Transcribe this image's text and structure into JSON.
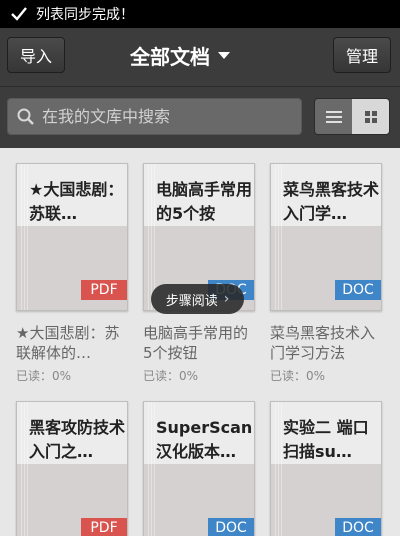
{
  "status": {
    "message": "列表同步完成！"
  },
  "header": {
    "import_label": "导入",
    "title": "全部文档",
    "manage_label": "管理"
  },
  "search": {
    "placeholder": "在我的文库中搜索"
  },
  "tooltip": {
    "label": "步骤阅读"
  },
  "documents": [
    {
      "cover_title": "★大国悲剧：苏联…",
      "title": "★大国悲剧：苏联解体的…",
      "read": "已读：0%",
      "type": "PDF"
    },
    {
      "cover_title": "电脑高手常用的5个按",
      "title": "电脑高手常用的5个按钮",
      "read": "已读：0%",
      "type": "DOC"
    },
    {
      "cover_title": "菜鸟黑客技术入门学…",
      "title": "菜鸟黑客技术入门学习方法",
      "read": "已读：0%",
      "type": "DOC"
    },
    {
      "cover_title": "黑客攻防技术入门之…",
      "title": "",
      "read": "",
      "type": "PDF"
    },
    {
      "cover_title": "SuperScan汉化版本…",
      "title": "",
      "read": "",
      "type": "DOC"
    },
    {
      "cover_title": "实验二 端口扫描su…",
      "title": "",
      "read": "",
      "type": "DOC"
    }
  ]
}
